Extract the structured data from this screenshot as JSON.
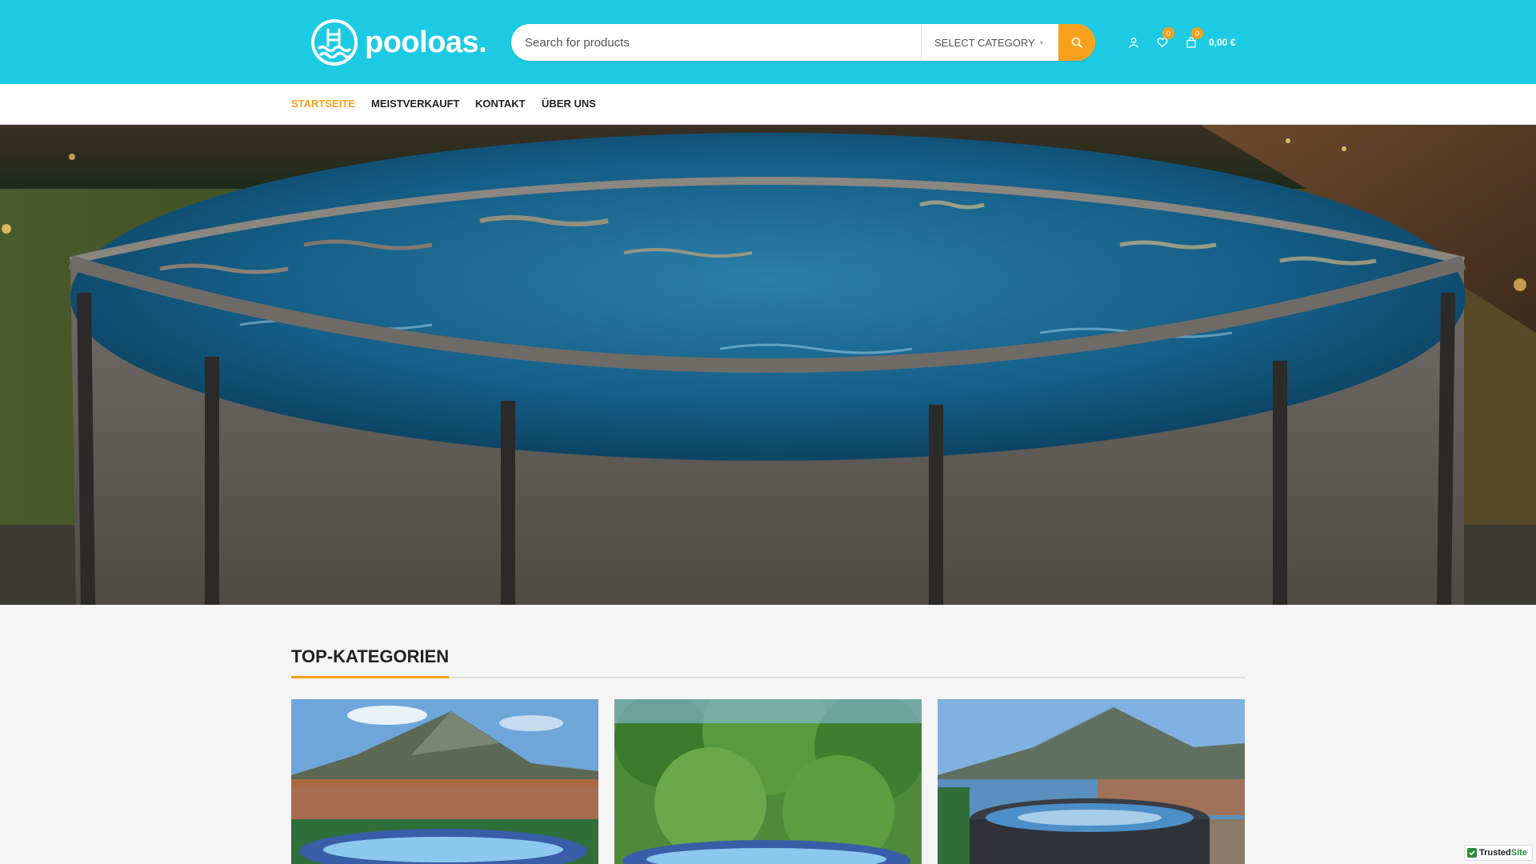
{
  "brand": {
    "name": "pooloas."
  },
  "search": {
    "placeholder": "Search for products",
    "category": "SELECT CATEGORY"
  },
  "header": {
    "wishlist_count": "0",
    "compare_count": "0",
    "cart_count": "0",
    "cart_total": "0,00 €"
  },
  "nav": {
    "items": [
      {
        "label": "STARTSEITE",
        "active": true
      },
      {
        "label": "MEISTVERKAUFT"
      },
      {
        "label": "KONTAKT"
      },
      {
        "label": "ÜBER UNS"
      }
    ]
  },
  "section": {
    "title": "TOP-KATEGORIEN"
  },
  "trusted": {
    "label_a": "Trusted",
    "label_b": "Site"
  },
  "colors": {
    "header_bg": "#1ccbe3",
    "accent": "#f7a11c",
    "nav_text": "#222222"
  }
}
